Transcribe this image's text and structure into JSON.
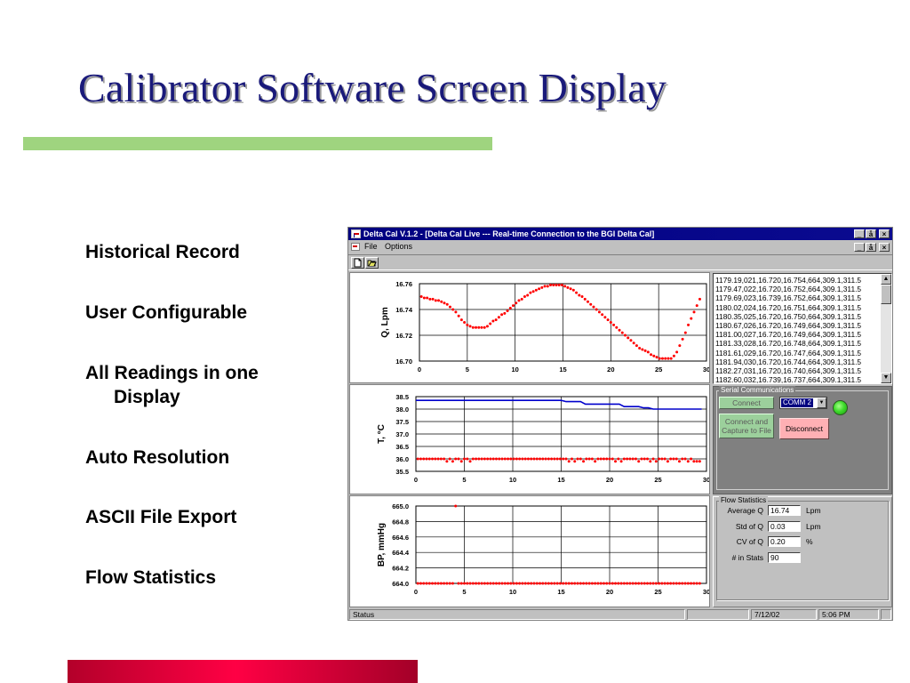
{
  "slide": {
    "title": "Calibrator Software Screen Display",
    "bullets": [
      {
        "line1": "Historical Record",
        "line2": ""
      },
      {
        "line1": "User Configurable",
        "line2": ""
      },
      {
        "line1": "All Readings in one",
        "line2": "Display"
      },
      {
        "line1": "Auto Resolution",
        "line2": ""
      },
      {
        "line1": "ASCII File Export",
        "line2": ""
      },
      {
        "line1": "Flow Statistics",
        "line2": ""
      }
    ],
    "colors": {
      "title": "#1a1a7a",
      "rule": "#9fd47f",
      "footer_bar": "#e0003a"
    }
  },
  "window": {
    "title": "Delta Cal V.1.2 - [Delta Cal Live --- Real-time Connection to the BGI Delta Cal]",
    "controls": [
      "_",
      "ǡ",
      "×"
    ],
    "menu": [
      {
        "label": "File"
      },
      {
        "label": "Options"
      }
    ],
    "toolbar_icons": [
      "new-file-icon",
      "open-folder-icon"
    ]
  },
  "chart_data": [
    {
      "type": "scatter",
      "ylabel": "Q, Lpm",
      "xlim": [
        0,
        30
      ],
      "ylim": [
        16.7,
        16.76
      ],
      "xticks": [
        "0",
        "5",
        "10",
        "15",
        "20",
        "25",
        "30"
      ],
      "yticks": [
        "16.76",
        "16.74",
        "16.72",
        "16.70"
      ],
      "grid": true,
      "series": [
        {
          "color": "#ff0000",
          "x": [
            0.2,
            0.5,
            0.8,
            1.1,
            1.4,
            1.7,
            2.0,
            2.3,
            2.6,
            2.9,
            3.2,
            3.5,
            3.8,
            4.1,
            4.4,
            4.7,
            5.0,
            5.3,
            5.6,
            5.9,
            6.2,
            6.5,
            6.8,
            7.1,
            7.4,
            7.7,
            8.0,
            8.3,
            8.6,
            8.9,
            9.2,
            9.5,
            9.8,
            10.1,
            10.4,
            10.7,
            11.0,
            11.3,
            11.6,
            11.9,
            12.2,
            12.5,
            12.8,
            13.1,
            13.4,
            13.7,
            14.0,
            14.3,
            14.6,
            14.9,
            15.2,
            15.5,
            15.8,
            16.1,
            16.4,
            16.7,
            17.0,
            17.3,
            17.6,
            17.9,
            18.2,
            18.5,
            18.8,
            19.1,
            19.4,
            19.7,
            20.0,
            20.3,
            20.6,
            20.9,
            21.2,
            21.5,
            21.8,
            22.1,
            22.4,
            22.7,
            23.0,
            23.3,
            23.6,
            23.9,
            24.2,
            24.5,
            24.8,
            25.1,
            25.4,
            25.7,
            26.0,
            26.3,
            26.6,
            26.9,
            27.2,
            27.5,
            27.8,
            28.1,
            28.4,
            28.7,
            29.0,
            29.3
          ],
          "y": [
            16.75,
            16.749,
            16.749,
            16.748,
            16.748,
            16.747,
            16.747,
            16.746,
            16.745,
            16.744,
            16.742,
            16.74,
            16.738,
            16.735,
            16.732,
            16.73,
            16.728,
            16.727,
            16.726,
            16.726,
            16.726,
            16.726,
            16.726,
            16.727,
            16.729,
            16.731,
            16.732,
            16.734,
            16.736,
            16.737,
            16.739,
            16.741,
            16.743,
            16.745,
            16.747,
            16.748,
            16.75,
            16.751,
            16.753,
            16.754,
            16.755,
            16.756,
            16.757,
            16.758,
            16.758,
            16.759,
            16.759,
            16.759,
            16.759,
            16.759,
            16.758,
            16.757,
            16.756,
            16.755,
            16.753,
            16.751,
            16.75,
            16.748,
            16.746,
            16.744,
            16.742,
            16.74,
            16.738,
            16.736,
            16.734,
            16.732,
            16.73,
            16.728,
            16.726,
            16.724,
            16.722,
            16.72,
            16.718,
            16.716,
            16.714,
            16.712,
            16.71,
            16.709,
            16.708,
            16.707,
            16.705,
            16.704,
            16.703,
            16.702,
            16.702,
            16.702,
            16.702,
            16.702,
            16.704,
            16.707,
            16.712,
            16.717,
            16.722,
            16.728,
            16.733,
            16.738,
            16.743,
            16.748
          ]
        }
      ]
    },
    {
      "type": "line",
      "ylabel": "T, °C",
      "xlim": [
        0,
        30
      ],
      "ylim": [
        35.5,
        38.5
      ],
      "xticks": [
        "0",
        "5",
        "10",
        "15",
        "20",
        "25",
        "30"
      ],
      "yticks": [
        "38.5",
        "38.0",
        "37.5",
        "37.0",
        "36.5",
        "36.0",
        "35.5"
      ],
      "grid": true,
      "series": [
        {
          "color": "#0000cc",
          "x": [
            0,
            15,
            15.5,
            17,
            17.5,
            21,
            21.5,
            23,
            23.5,
            24,
            24.5,
            29.5
          ],
          "y": [
            38.35,
            38.35,
            38.3,
            38.3,
            38.2,
            38.2,
            38.1,
            38.1,
            38.05,
            38.05,
            38.0,
            38.0
          ]
        },
        {
          "color": "#ff0000",
          "x": [
            0.2,
            0.5,
            0.8,
            1.1,
            1.4,
            1.7,
            2.0,
            2.3,
            2.6,
            2.9,
            3.2,
            3.5,
            3.8,
            4.1,
            4.4,
            4.7,
            5.0,
            5.3,
            5.6,
            5.9,
            6.2,
            6.5,
            6.8,
            7.1,
            7.4,
            7.7,
            8.0,
            8.3,
            8.6,
            8.9,
            9.2,
            9.5,
            9.8,
            10.1,
            10.4,
            10.7,
            11.0,
            11.3,
            11.6,
            11.9,
            12.2,
            12.5,
            12.8,
            13.1,
            13.4,
            13.7,
            14.0,
            14.3,
            14.6,
            14.9,
            15.2,
            15.5,
            15.8,
            16.1,
            16.4,
            16.7,
            17.0,
            17.3,
            17.6,
            17.9,
            18.2,
            18.5,
            18.8,
            19.1,
            19.4,
            19.7,
            20.0,
            20.3,
            20.6,
            20.9,
            21.2,
            21.5,
            21.8,
            22.1,
            22.4,
            22.7,
            23.0,
            23.3,
            23.6,
            23.9,
            24.2,
            24.5,
            24.8,
            25.1,
            25.4,
            25.7,
            26.0,
            26.3,
            26.6,
            26.9,
            27.2,
            27.5,
            27.8,
            28.1,
            28.4,
            28.7,
            29.0,
            29.3
          ],
          "y": [
            36.0,
            36.0,
            36.0,
            36.0,
            36.0,
            36.0,
            36.0,
            36.0,
            36.0,
            36.0,
            35.9,
            36.0,
            35.9,
            36.0,
            36.0,
            35.9,
            36.0,
            36.0,
            35.9,
            36.0,
            36.0,
            36.0,
            36.0,
            36.0,
            36.0,
            36.0,
            36.0,
            36.0,
            36.0,
            36.0,
            36.0,
            36.0,
            36.0,
            36.0,
            36.0,
            36.0,
            36.0,
            36.0,
            36.0,
            36.0,
            36.0,
            36.0,
            36.0,
            36.0,
            36.0,
            36.0,
            36.0,
            36.0,
            36.0,
            36.0,
            36.0,
            36.0,
            35.9,
            36.0,
            35.9,
            36.0,
            36.0,
            35.9,
            36.0,
            36.0,
            36.0,
            35.9,
            36.0,
            36.0,
            36.0,
            36.0,
            36.0,
            36.0,
            35.9,
            36.0,
            35.9,
            36.0,
            36.0,
            36.0,
            36.0,
            36.0,
            35.9,
            36.0,
            36.0,
            36.0,
            35.9,
            36.0,
            35.9,
            36.0,
            36.0,
            36.0,
            35.9,
            36.0,
            36.0,
            36.0,
            35.9,
            36.0,
            36.0,
            35.9,
            36.0,
            35.9,
            35.9,
            35.9
          ]
        }
      ]
    },
    {
      "type": "scatter",
      "ylabel": "BP, mmHg",
      "xlim": [
        0,
        30
      ],
      "ylim": [
        664.0,
        665.0
      ],
      "xticks": [
        "0",
        "5",
        "10",
        "15",
        "20",
        "25",
        "30"
      ],
      "yticks": [
        "665.0",
        "664.8",
        "664.6",
        "664.4",
        "664.2",
        "664.0"
      ],
      "grid": true,
      "series": [
        {
          "color": "#ff0000",
          "x": [
            0.2,
            0.5,
            0.8,
            1.1,
            1.4,
            1.7,
            2.0,
            2.3,
            2.6,
            2.9,
            3.2,
            3.5,
            3.8,
            4.1,
            4.4,
            4.7,
            5.0,
            5.3,
            5.6,
            5.9,
            6.2,
            6.5,
            6.8,
            7.1,
            7.4,
            7.7,
            8.0,
            8.3,
            8.6,
            8.9,
            9.2,
            9.5,
            9.8,
            10.1,
            10.4,
            10.7,
            11.0,
            11.3,
            11.6,
            11.9,
            12.2,
            12.5,
            12.8,
            13.1,
            13.4,
            13.7,
            14.0,
            14.3,
            14.6,
            14.9,
            15.2,
            15.5,
            15.8,
            16.1,
            16.4,
            16.7,
            17.0,
            17.3,
            17.6,
            17.9,
            18.2,
            18.5,
            18.8,
            19.1,
            19.4,
            19.7,
            20.0,
            20.3,
            20.6,
            20.9,
            21.2,
            21.5,
            21.8,
            22.1,
            22.4,
            22.7,
            23.0,
            23.3,
            23.6,
            23.9,
            24.2,
            24.5,
            24.8,
            25.1,
            25.4,
            25.7,
            26.0,
            26.3,
            26.6,
            26.9,
            27.2,
            27.5,
            27.8,
            28.1,
            28.4,
            28.7,
            29.0,
            29.3
          ],
          "y": [
            664.0,
            664.0,
            664.0,
            664.0,
            664.0,
            664.0,
            664.0,
            664.0,
            664.0,
            664.0,
            664.0,
            664.0,
            664.0,
            665.0,
            664.0,
            664.0,
            664.0,
            664.0,
            664.0,
            664.0,
            664.0,
            664.0,
            664.0,
            664.0,
            664.0,
            664.0,
            664.0,
            664.0,
            664.0,
            664.0,
            664.0,
            664.0,
            664.0,
            664.0,
            664.0,
            664.0,
            664.0,
            664.0,
            664.0,
            664.0,
            664.0,
            664.0,
            664.0,
            664.0,
            664.0,
            664.0,
            664.0,
            664.0,
            664.0,
            664.0,
            664.0,
            664.0,
            664.0,
            664.0,
            664.0,
            664.0,
            664.0,
            664.0,
            664.0,
            664.0,
            664.0,
            664.0,
            664.0,
            664.0,
            664.0,
            664.0,
            664.0,
            664.0,
            664.0,
            664.0,
            664.0,
            664.0,
            664.0,
            664.0,
            664.0,
            664.0,
            664.0,
            664.0,
            664.0,
            664.0,
            664.0,
            664.0,
            664.0,
            664.0,
            664.0,
            664.0,
            664.0,
            664.0,
            664.0,
            664.0,
            664.0,
            664.0,
            664.0,
            664.0,
            664.0,
            664.0,
            664.0,
            664.0
          ]
        }
      ]
    }
  ],
  "log": {
    "lines": [
      "1179.19,021,16.720,16.754,664,309.1,311.5",
      "1179.47,022,16.720,16.752,664,309.1,311.5",
      "1179.69,023,16.739,16.752,664,309.1,311.5",
      "1180.02,024,16.720,16.751,664,309.1,311.5",
      "1180.35,025,16.720,16.750,664,309.1,311.5",
      "1180.67,026,16.720,16.749,664,309.1,311.5",
      "1181.00,027,16.720,16.749,664,309.1,311.5",
      "1181.33,028,16.720,16.748,664,309.1,311.5",
      "1181.61,029,16.720,16.747,664,309.1,311.5",
      "1181.94,030,16.720,16.744,664,309.1,311.5",
      "1182.27,031,16.720,16.740,664,309.1,311.5",
      "1182.60,032,16.739,16.737,664,309.1,311.5"
    ]
  },
  "serial": {
    "group_label": "Serial Communications",
    "connect_label": "Connect",
    "port_value": "COMM 2",
    "capture_label_1": "Connect and",
    "capture_label_2": "Capture to File",
    "disconnect_label": "Disconnect",
    "led_color": "#3fdc2c"
  },
  "flow_stats": {
    "group_label": "Flow Statistics",
    "rows": [
      {
        "label": "Average Q",
        "value": "16.74",
        "unit": "Lpm"
      },
      {
        "label": "Std of Q",
        "value": "0.03",
        "unit": "Lpm"
      },
      {
        "label": "CV of Q",
        "value": "0.20",
        "unit": "%"
      },
      {
        "label": "# in Stats",
        "value": "90",
        "unit": ""
      }
    ]
  },
  "statusbar": {
    "status": "Status",
    "date": "7/12/02",
    "time": "5:06 PM"
  }
}
